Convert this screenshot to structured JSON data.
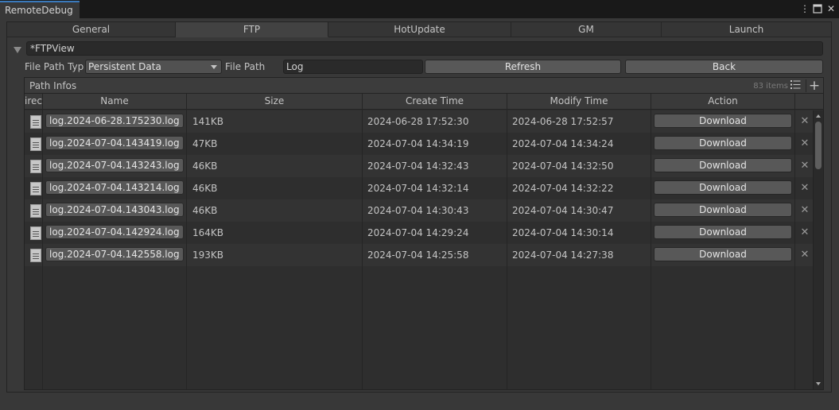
{
  "window": {
    "title": "RemoteDebug",
    "menu_icon": "vertical-ellipsis-icon",
    "maximize_icon": "maximize-icon",
    "close_icon": "close-icon"
  },
  "tabs": [
    {
      "label": "General",
      "active": false
    },
    {
      "label": "FTP",
      "active": true
    },
    {
      "label": "HotUpdate",
      "active": false
    },
    {
      "label": "GM",
      "active": false
    },
    {
      "label": "Launch",
      "active": false
    }
  ],
  "foldout": {
    "value": "*FTPView"
  },
  "controls": {
    "file_path_type_label": "File Path Typ",
    "file_path_type_value": "Persistent Data",
    "file_path_label": "File Path",
    "file_path_value": "Log",
    "refresh_label": "Refresh",
    "back_label": "Back"
  },
  "list": {
    "title": "Path Infos",
    "count": "83 items",
    "columns": [
      "irec",
      "Name",
      "Size",
      "Create Time",
      "Modify Time",
      "Action"
    ],
    "rows": [
      {
        "name": "log.2024-06-28.175230.log",
        "size": "141KB",
        "created": "2024-06-28 17:52:30",
        "modified": "2024-06-28 17:52:57",
        "action": "Download"
      },
      {
        "name": "log.2024-07-04.143419.log",
        "size": "47KB",
        "created": "2024-07-04 14:34:19",
        "modified": "2024-07-04 14:34:24",
        "action": "Download"
      },
      {
        "name": "log.2024-07-04.143243.log",
        "size": "46KB",
        "created": "2024-07-04 14:32:43",
        "modified": "2024-07-04 14:32:50",
        "action": "Download"
      },
      {
        "name": "log.2024-07-04.143214.log",
        "size": "46KB",
        "created": "2024-07-04 14:32:14",
        "modified": "2024-07-04 14:32:22",
        "action": "Download"
      },
      {
        "name": "log.2024-07-04.143043.log",
        "size": "46KB",
        "created": "2024-07-04 14:30:43",
        "modified": "2024-07-04 14:30:47",
        "action": "Download"
      },
      {
        "name": "log.2024-07-04.142924.log",
        "size": "164KB",
        "created": "2024-07-04 14:29:24",
        "modified": "2024-07-04 14:30:14",
        "action": "Download"
      },
      {
        "name": "log.2024-07-04.142558.log",
        "size": "193KB",
        "created": "2024-07-04 14:25:58",
        "modified": "2024-07-04 14:27:38",
        "action": "Download"
      }
    ]
  },
  "colors": {
    "background": "#383838",
    "titlebar": "#191919",
    "accent": "#3a79bb",
    "button": "#585858",
    "field": "#2a2a2a"
  }
}
